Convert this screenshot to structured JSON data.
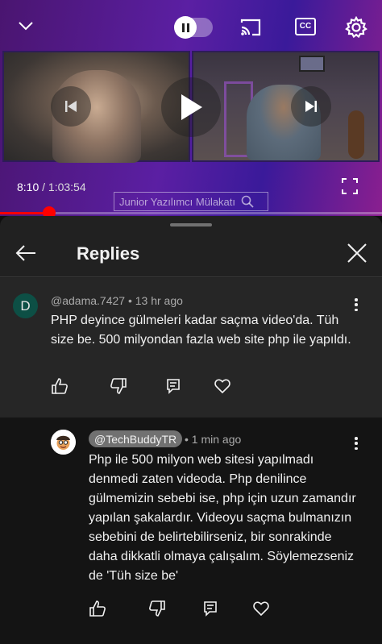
{
  "player": {
    "current_time": "8:10",
    "separator": "/",
    "duration": "1:03:54",
    "progress": 0.128,
    "watermark_text": "Junior Yazılımcı Mülakatı",
    "cc_label": "CC"
  },
  "panel": {
    "title": "Replies"
  },
  "parent_comment": {
    "avatar_letter": "D",
    "author": "@adama.7427",
    "time": "13 hr ago",
    "text": "PHP deyince gülmeleri kadar saçma video'da. Tüh size be. 500 milyondan fazla web site php ile yapıldı."
  },
  "reply_comment": {
    "author": "@TechBuddyTR",
    "time": "1 min ago",
    "text": "Php ile 500 milyon web sitesi yapılmadı denmedi zaten videoda. Php denilince gülmemizin sebebi ise, php için uzun zamandır yapılan şakalardır. Videoyu saçma bulmanızın sebebini de belirtebilirseniz, bir sonrakinde daha dikkatli olmaya çalışalım. Söylemezseniz de 'Tüh size be'"
  },
  "meta_separator": "•",
  "icons": {
    "collapse": "chevron-down-icon",
    "autoplay": "pause-toggle",
    "cast": "cast-icon",
    "captions": "cc-icon",
    "settings": "gear-icon",
    "back": "arrow-left-icon",
    "close": "close-icon",
    "like": "thumb-up-icon",
    "dislike": "thumb-down-icon",
    "reply": "comment-icon",
    "heart": "heart-icon"
  },
  "colors": {
    "progress": "#ff0000",
    "panel_bg": "#212121",
    "avatar_d": "#0d4f45"
  }
}
